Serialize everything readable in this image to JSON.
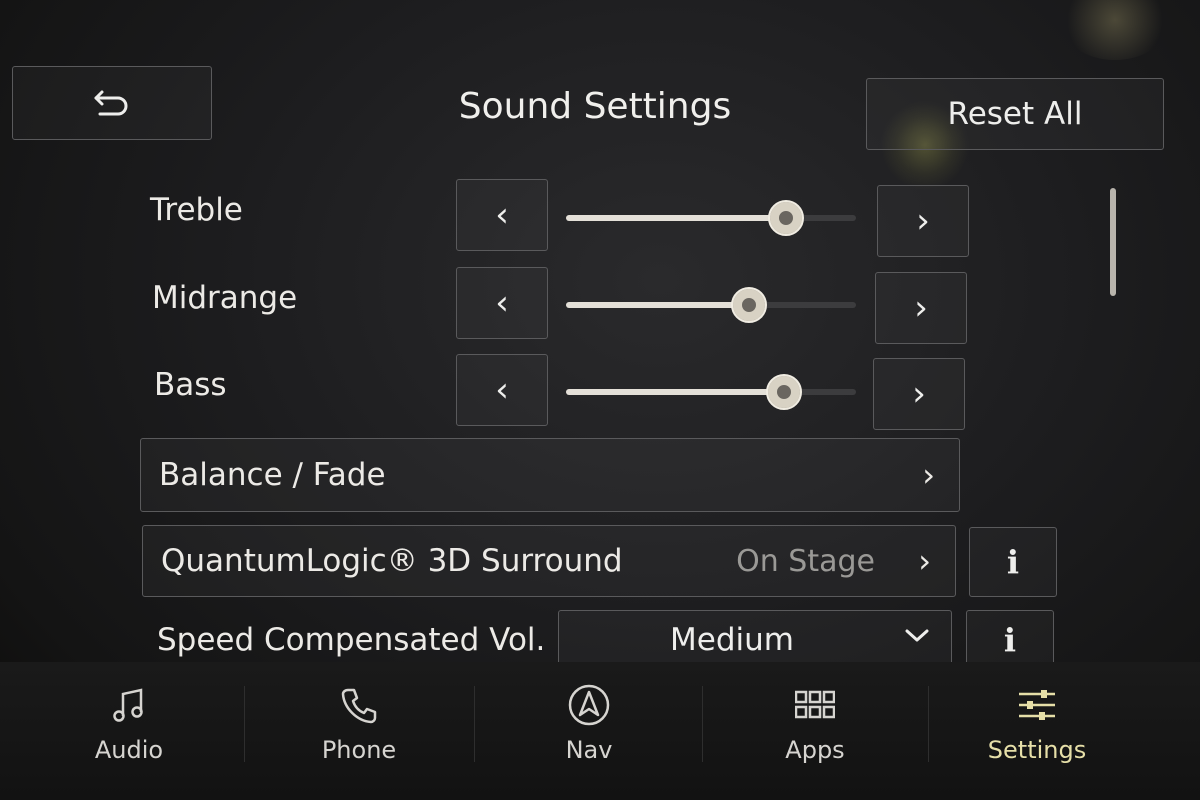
{
  "header": {
    "back_icon": "back-arrow-icon",
    "title": "Sound Settings",
    "reset_label": "Reset All"
  },
  "sliders": [
    {
      "label": "Treble",
      "level": 0.76
    },
    {
      "label": "Midrange",
      "level": 0.63
    },
    {
      "label": "Bass",
      "level": 0.75
    }
  ],
  "controls": {
    "decrease_glyph": "‹",
    "increase_glyph": "›"
  },
  "rows": {
    "balance_fade": {
      "label": "Balance / Fade",
      "chevron": "›"
    },
    "surround": {
      "label": "QuantumLogic® 3D Surround",
      "value": "On Stage",
      "chevron": "›",
      "info": "i"
    },
    "speed_comp": {
      "label": "Speed Compensated Vol.",
      "value": "Medium",
      "info": "i"
    }
  },
  "nav": {
    "items": [
      {
        "label": "Audio",
        "icon": "music-note-icon"
      },
      {
        "label": "Phone",
        "icon": "phone-icon"
      },
      {
        "label": "Nav",
        "icon": "navigation-icon"
      },
      {
        "label": "Apps",
        "icon": "apps-grid-icon"
      },
      {
        "label": "Settings",
        "icon": "settings-sliders-icon",
        "active": true
      }
    ]
  },
  "colors": {
    "accent_active": "#e6dfa8",
    "text": "#eceae6",
    "muted_value": "#9a9996"
  }
}
